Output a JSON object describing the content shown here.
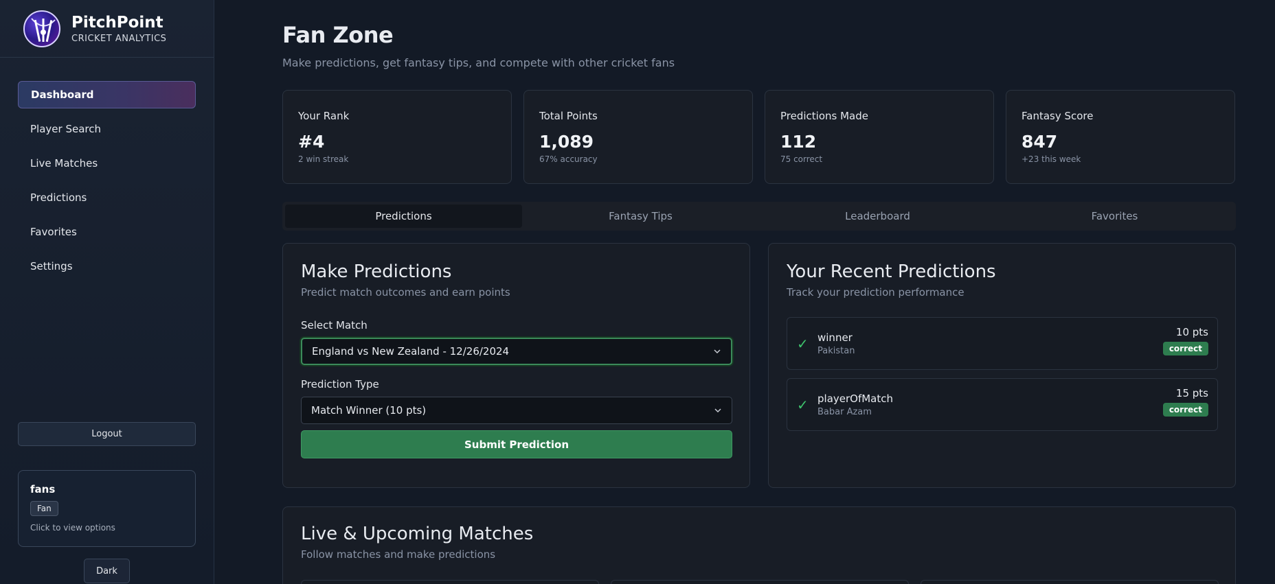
{
  "brand": {
    "name": "PitchPoint",
    "subtitle": "CRICKET ANALYTICS"
  },
  "sidebar": {
    "items": [
      {
        "label": "Dashboard",
        "active": true
      },
      {
        "label": "Player Search"
      },
      {
        "label": "Live Matches"
      },
      {
        "label": "Predictions"
      },
      {
        "label": "Favorites"
      },
      {
        "label": "Settings"
      }
    ],
    "logout_label": "Logout",
    "user": {
      "name": "fans",
      "role": "Fan",
      "hint": "Click to view options"
    },
    "theme_label": "Dark"
  },
  "page": {
    "title": "Fan Zone",
    "subtitle": "Make predictions, get fantasy tips, and compete with other cricket fans"
  },
  "stats": [
    {
      "label": "Your Rank",
      "value": "#4",
      "sub": "2 win streak"
    },
    {
      "label": "Total Points",
      "value": "1,089",
      "sub": "67% accuracy"
    },
    {
      "label": "Predictions Made",
      "value": "112",
      "sub": "75 correct"
    },
    {
      "label": "Fantasy Score",
      "value": "847",
      "sub": "+23 this week"
    }
  ],
  "tabs": [
    {
      "label": "Predictions",
      "active": true
    },
    {
      "label": "Fantasy Tips"
    },
    {
      "label": "Leaderboard"
    },
    {
      "label": "Favorites"
    }
  ],
  "make_predictions": {
    "title": "Make Predictions",
    "subtitle": "Predict match outcomes and earn points",
    "match_label": "Select Match",
    "match_value": "England vs New Zealand - 12/26/2024",
    "type_label": "Prediction Type",
    "type_value": "Match Winner (10 pts)",
    "submit_label": "Submit Prediction"
  },
  "recent_predictions": {
    "title": "Your Recent Predictions",
    "subtitle": "Track your prediction performance",
    "items": [
      {
        "title": "winner",
        "sub": "Pakistan",
        "points": "10 pts",
        "status": "correct"
      },
      {
        "title": "playerOfMatch",
        "sub": "Babar Azam",
        "points": "15 pts",
        "status": "correct"
      }
    ]
  },
  "live": {
    "title": "Live & Upcoming Matches",
    "subtitle": "Follow matches and make predictions"
  },
  "colors": {
    "accent_green": "#2e7d4f",
    "check_green": "#3ec46d",
    "bg": "#131a26"
  }
}
